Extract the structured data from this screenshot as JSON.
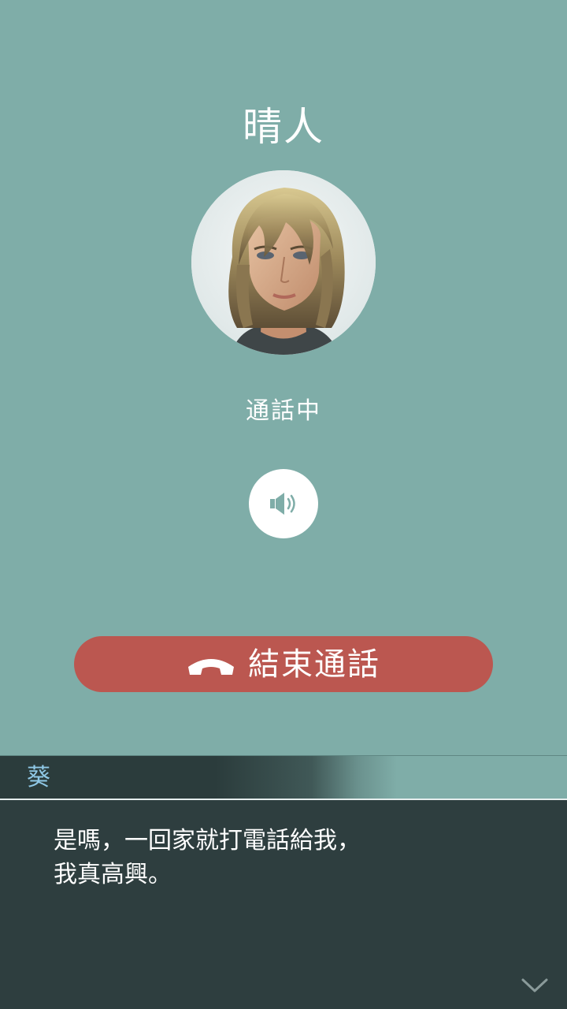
{
  "call": {
    "caller_name": "晴人",
    "status": "通話中",
    "end_call_label": "結束通話",
    "avatar": "caller-portrait"
  },
  "icons": {
    "speaker": "speaker-icon",
    "end_call": "phone-hangup-icon",
    "advance": "chevron-down-icon"
  },
  "dialogue": {
    "speaker": "葵",
    "lines": [
      "是嗎，一回家就打電話給我，",
      "我真高興。"
    ]
  },
  "colors": {
    "background": "#7fada8",
    "end_call_button": "#bb5750",
    "dialogue_box": "#2e3e3f",
    "speaker_name": "#8fc8e6"
  }
}
